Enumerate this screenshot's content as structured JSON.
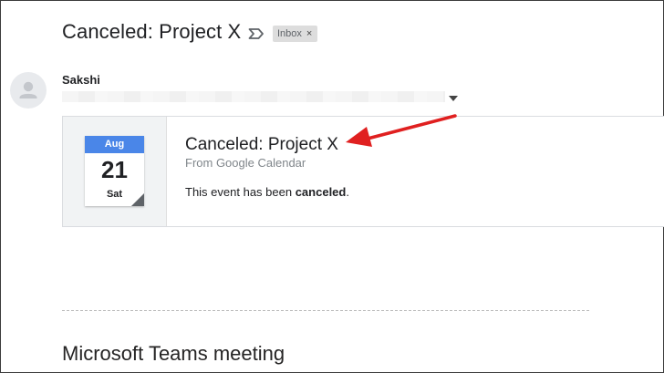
{
  "email": {
    "subject": "Canceled: Project X",
    "label": "Inbox",
    "label_close": "×",
    "sender_name": "Sakshi"
  },
  "calendar_card": {
    "month": "Aug",
    "day": "21",
    "weekday": "Sat",
    "title": "Canceled: Project X",
    "source": "From Google Calendar",
    "message_prefix": "This event has been ",
    "message_bold": "canceled",
    "message_suffix": "."
  },
  "body": {
    "teams_heading": "Microsoft Teams meeting"
  },
  "colors": {
    "calendar_month_bg": "#4a86e8",
    "annotation_arrow": "#e02020"
  },
  "icons": {
    "importance": "importance-marker-icon",
    "avatar": "person-avatar-icon",
    "caret": "caret-down-icon",
    "annotation": "red-arrow-annotation"
  }
}
